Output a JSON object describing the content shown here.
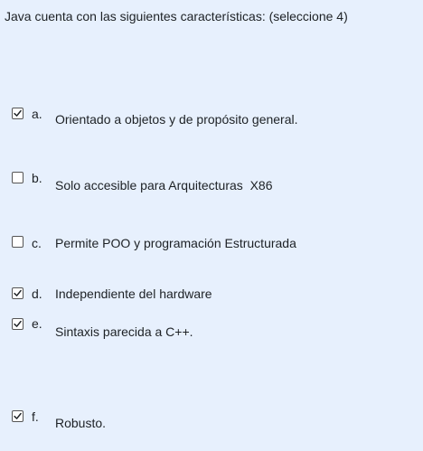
{
  "question": {
    "text": "Java cuenta con las siguientes características: (seleccione 4)"
  },
  "options": [
    {
      "letter": "a.",
      "text": "Orientado a objetos y de propósito general.",
      "checked": true
    },
    {
      "letter": "b.",
      "text": "Solo accesible para Arquitecturas  X86",
      "checked": false
    },
    {
      "letter": "c.",
      "text": "Permite POO y programación Estructurada",
      "checked": false
    },
    {
      "letter": "d.",
      "text": "Independiente del hardware",
      "checked": true
    },
    {
      "letter": "e.",
      "text": "Sintaxis parecida a C++.",
      "checked": true
    },
    {
      "letter": "f.",
      "text": "Robusto.",
      "checked": true
    }
  ]
}
